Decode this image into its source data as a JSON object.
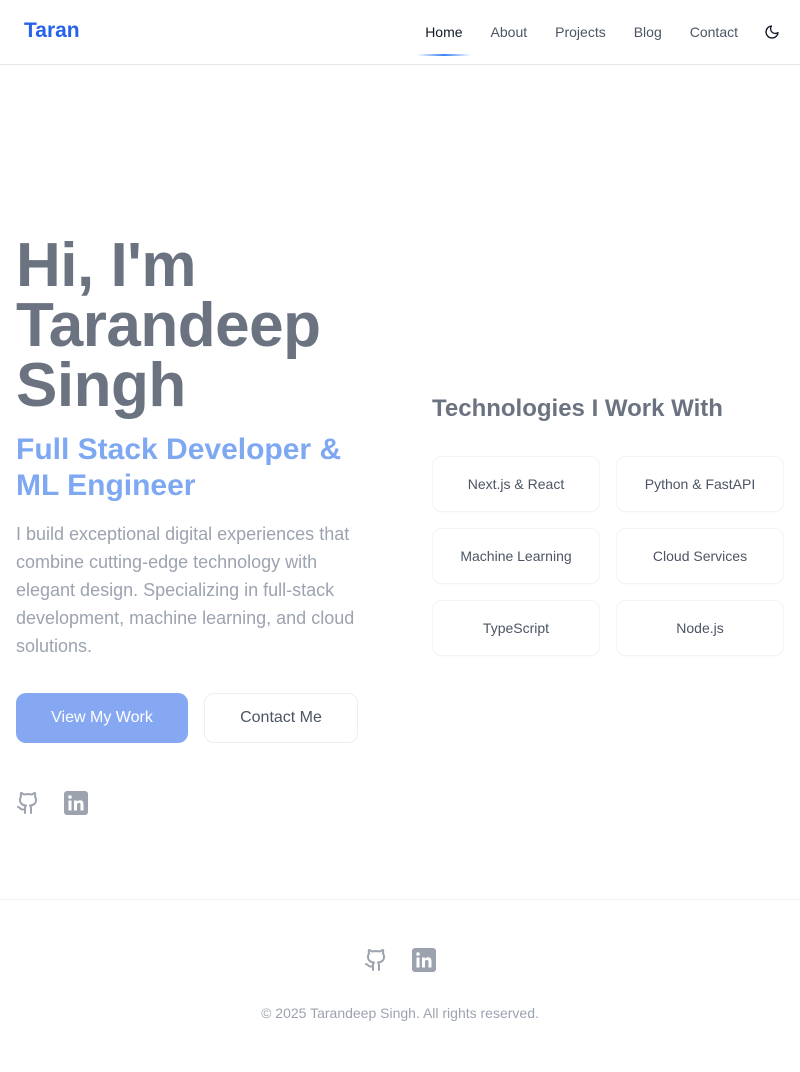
{
  "brand": {
    "logo": "Taran",
    "accent_color": "#2563eb"
  },
  "nav": {
    "links": [
      {
        "label": "Home",
        "active": true
      },
      {
        "label": "About"
      },
      {
        "label": "Projects"
      },
      {
        "label": "Blog"
      },
      {
        "label": "Contact"
      }
    ],
    "theme_toggle_icon": "moon-icon"
  },
  "hero": {
    "title_lines": [
      "Hi, I'm",
      "Tarandeep",
      "Singh"
    ],
    "subtitle_lines": [
      "Full Stack Developer &",
      "ML Engineer"
    ],
    "description": "I build exceptional digital experiences that combine cutting-edge technology with elegant design. Specializing in full-stack development, machine learning, and cloud solutions.",
    "primary_button": "View My Work",
    "secondary_button": "Contact Me",
    "social_icons": [
      "github-icon",
      "linkedin-icon"
    ]
  },
  "technologies": {
    "title": "Technologies I Work With",
    "items": [
      "Next.js & React",
      "Python & FastAPI",
      "Machine Learning",
      "Cloud Services",
      "TypeScript",
      "Node.js"
    ]
  },
  "footer": {
    "social_icons": [
      "github-icon",
      "linkedin-icon"
    ],
    "copyright": "© 2025 Tarandeep Singh. All rights reserved."
  }
}
